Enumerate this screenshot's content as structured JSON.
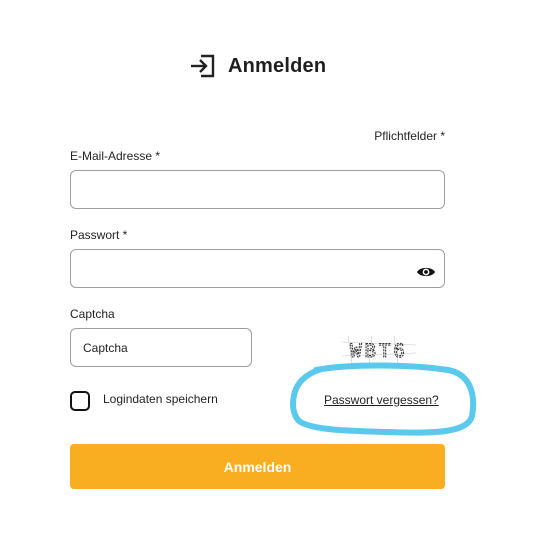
{
  "header": {
    "icon": "login-arrow-icon",
    "title": "Anmelden"
  },
  "form": {
    "required_note": "Pflichtfelder *",
    "email": {
      "label": "E-Mail-Adresse *",
      "value": "",
      "placeholder": ""
    },
    "password": {
      "label": "Passwort *",
      "value": "",
      "placeholder": "",
      "toggle_icon": "eye-icon"
    },
    "captcha": {
      "label": "Captcha",
      "placeholder": "Captcha",
      "image_text": "WBT6"
    },
    "remember": {
      "label": "Logindaten speichern",
      "checked": false
    },
    "forgot_password": "Passwort vergessen?",
    "submit_label": "Anmelden"
  },
  "colors": {
    "accent": "#f9ae22",
    "highlight": "#5bc8ee",
    "text": "#222222",
    "border": "#9e9e9e"
  }
}
